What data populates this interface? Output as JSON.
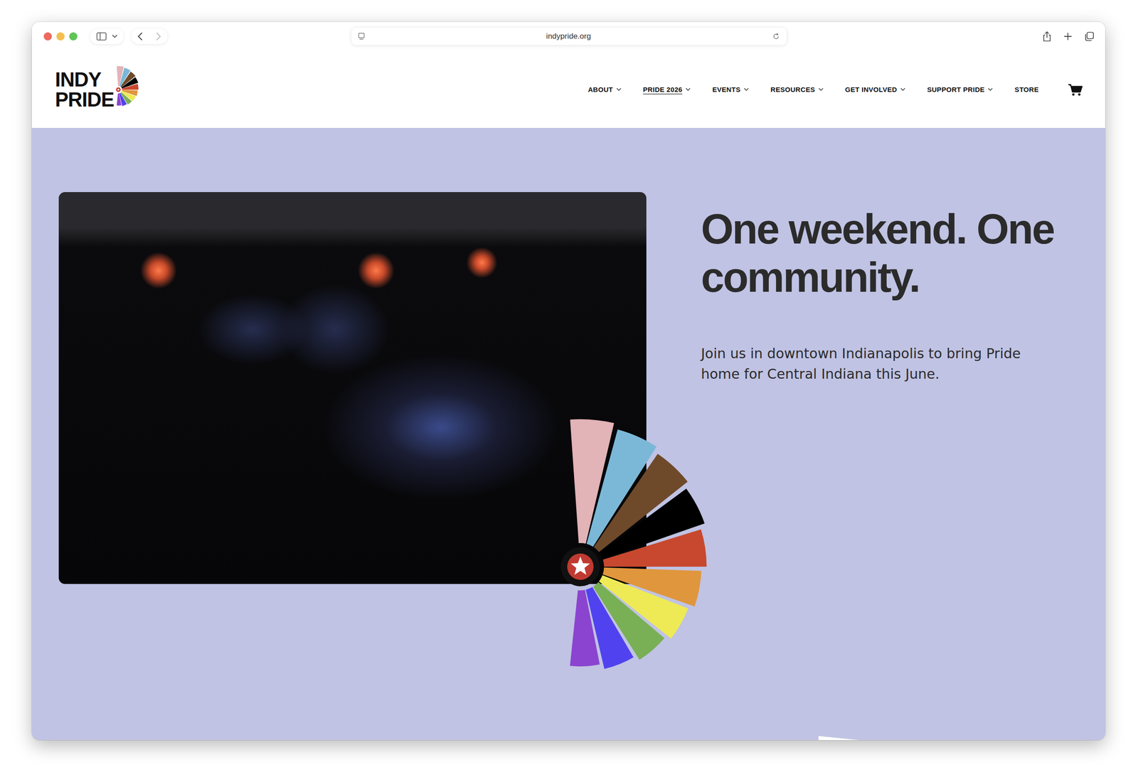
{
  "browser": {
    "url": "indypride.org"
  },
  "logo": {
    "lines": [
      "INDY",
      "PRIDE"
    ]
  },
  "nav": [
    {
      "label": "ABOUT",
      "selected": false,
      "has_menu": true
    },
    {
      "label": "PRIDE 2026",
      "selected": true,
      "has_menu": true
    },
    {
      "label": "EVENTS",
      "selected": false,
      "has_menu": true
    },
    {
      "label": "RESOURCES",
      "selected": false,
      "has_menu": true
    },
    {
      "label": "GET INVOLVED",
      "selected": false,
      "has_menu": true
    },
    {
      "label": "SUPPORT PRIDE",
      "selected": false,
      "has_menu": true
    },
    {
      "label": "STORE",
      "selected": false,
      "has_menu": false
    }
  ],
  "hero": {
    "heading": "One weekend. One community.",
    "text": "Join us in downtown Indianapolis to bring Pride home for Central Indiana this June."
  },
  "fan": [
    {
      "color": "#e2b3b7"
    },
    {
      "color": "#7bb8d8"
    },
    {
      "color": "#6e4a2a"
    },
    {
      "color": "#000000"
    },
    {
      "color": "#c8482f"
    },
    {
      "color": "#e0963c"
    },
    {
      "color": "#eeea55"
    },
    {
      "color": "#79b055"
    },
    {
      "color": "#5142ef"
    },
    {
      "color": "#8b44d0"
    }
  ]
}
